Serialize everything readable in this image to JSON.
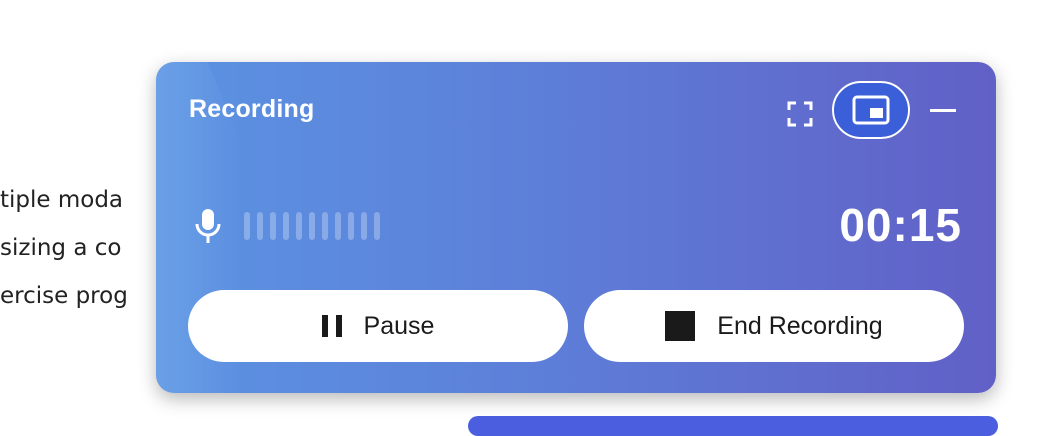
{
  "background": {
    "lines": [
      "tiple moda",
      "sizing a co",
      "ercise prog"
    ]
  },
  "widget": {
    "title": "Recording",
    "timer": "00:15",
    "controls": {
      "fullscreen_icon": "fullscreen-icon",
      "pip_icon": "picture-in-picture-icon",
      "minimize_icon": "minimize-icon"
    },
    "mic_icon": "microphone-icon",
    "level_bars": 11,
    "pause_label": "Pause",
    "end_label": "End Recording"
  },
  "colors": {
    "gradient_start": "#5b93e2",
    "gradient_end": "#6160c7",
    "pip_active": "#3a5fd8",
    "button_bg": "#ffffff"
  }
}
